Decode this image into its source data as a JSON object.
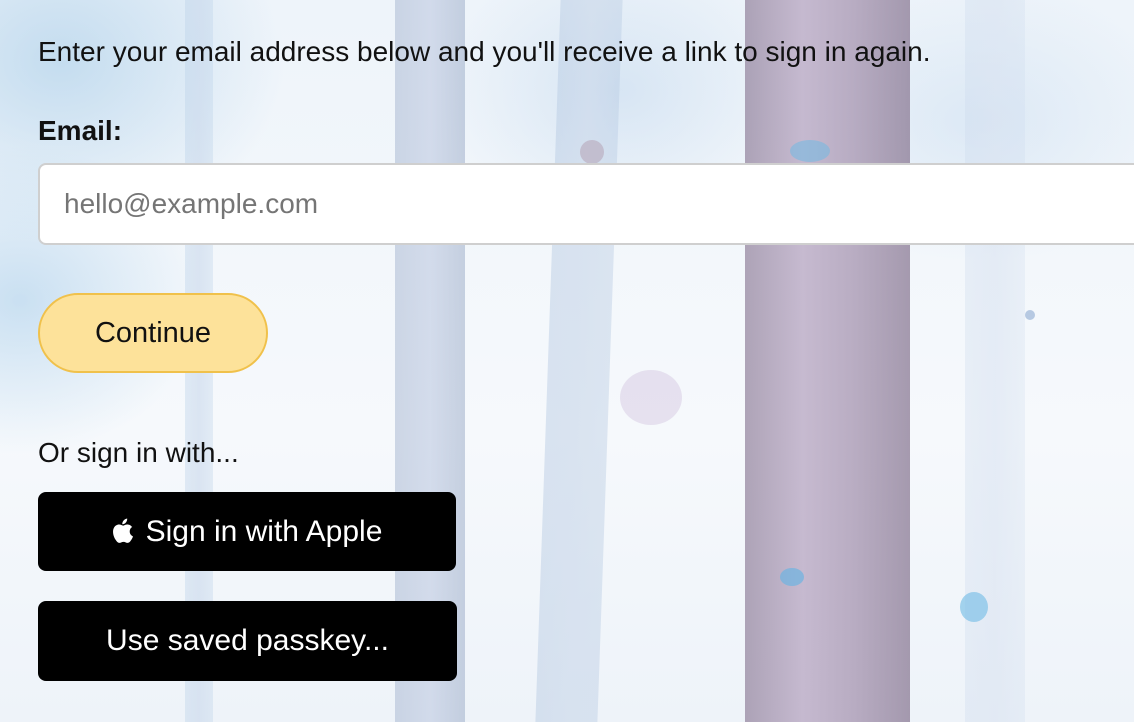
{
  "intro_text": "Enter your email address below and you'll receive a link to sign in again.",
  "email": {
    "label": "Email:",
    "placeholder": "hello@example.com",
    "value": ""
  },
  "continue_button": {
    "label": "Continue",
    "color": "#fde29a",
    "border_color": "#f0c14b"
  },
  "alternatives": {
    "heading": "Or sign in with...",
    "apple_button": {
      "icon": "apple-logo-icon",
      "label": "Sign in with Apple"
    },
    "passkey_button": {
      "label": "Use saved passkey..."
    },
    "button_color": "#000000"
  }
}
